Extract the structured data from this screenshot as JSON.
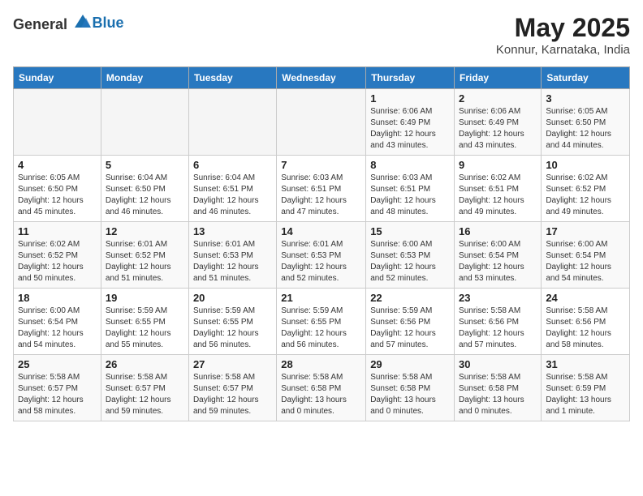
{
  "header": {
    "logo_general": "General",
    "logo_blue": "Blue",
    "month_year": "May 2025",
    "location": "Konnur, Karnataka, India"
  },
  "days_of_week": [
    "Sunday",
    "Monday",
    "Tuesday",
    "Wednesday",
    "Thursday",
    "Friday",
    "Saturday"
  ],
  "weeks": [
    [
      {
        "day": "",
        "info": ""
      },
      {
        "day": "",
        "info": ""
      },
      {
        "day": "",
        "info": ""
      },
      {
        "day": "",
        "info": ""
      },
      {
        "day": "1",
        "info": "Sunrise: 6:06 AM\nSunset: 6:49 PM\nDaylight: 12 hours\nand 43 minutes."
      },
      {
        "day": "2",
        "info": "Sunrise: 6:06 AM\nSunset: 6:49 PM\nDaylight: 12 hours\nand 43 minutes."
      },
      {
        "day": "3",
        "info": "Sunrise: 6:05 AM\nSunset: 6:50 PM\nDaylight: 12 hours\nand 44 minutes."
      }
    ],
    [
      {
        "day": "4",
        "info": "Sunrise: 6:05 AM\nSunset: 6:50 PM\nDaylight: 12 hours\nand 45 minutes."
      },
      {
        "day": "5",
        "info": "Sunrise: 6:04 AM\nSunset: 6:50 PM\nDaylight: 12 hours\nand 46 minutes."
      },
      {
        "day": "6",
        "info": "Sunrise: 6:04 AM\nSunset: 6:51 PM\nDaylight: 12 hours\nand 46 minutes."
      },
      {
        "day": "7",
        "info": "Sunrise: 6:03 AM\nSunset: 6:51 PM\nDaylight: 12 hours\nand 47 minutes."
      },
      {
        "day": "8",
        "info": "Sunrise: 6:03 AM\nSunset: 6:51 PM\nDaylight: 12 hours\nand 48 minutes."
      },
      {
        "day": "9",
        "info": "Sunrise: 6:02 AM\nSunset: 6:51 PM\nDaylight: 12 hours\nand 49 minutes."
      },
      {
        "day": "10",
        "info": "Sunrise: 6:02 AM\nSunset: 6:52 PM\nDaylight: 12 hours\nand 49 minutes."
      }
    ],
    [
      {
        "day": "11",
        "info": "Sunrise: 6:02 AM\nSunset: 6:52 PM\nDaylight: 12 hours\nand 50 minutes."
      },
      {
        "day": "12",
        "info": "Sunrise: 6:01 AM\nSunset: 6:52 PM\nDaylight: 12 hours\nand 51 minutes."
      },
      {
        "day": "13",
        "info": "Sunrise: 6:01 AM\nSunset: 6:53 PM\nDaylight: 12 hours\nand 51 minutes."
      },
      {
        "day": "14",
        "info": "Sunrise: 6:01 AM\nSunset: 6:53 PM\nDaylight: 12 hours\nand 52 minutes."
      },
      {
        "day": "15",
        "info": "Sunrise: 6:00 AM\nSunset: 6:53 PM\nDaylight: 12 hours\nand 52 minutes."
      },
      {
        "day": "16",
        "info": "Sunrise: 6:00 AM\nSunset: 6:54 PM\nDaylight: 12 hours\nand 53 minutes."
      },
      {
        "day": "17",
        "info": "Sunrise: 6:00 AM\nSunset: 6:54 PM\nDaylight: 12 hours\nand 54 minutes."
      }
    ],
    [
      {
        "day": "18",
        "info": "Sunrise: 6:00 AM\nSunset: 6:54 PM\nDaylight: 12 hours\nand 54 minutes."
      },
      {
        "day": "19",
        "info": "Sunrise: 5:59 AM\nSunset: 6:55 PM\nDaylight: 12 hours\nand 55 minutes."
      },
      {
        "day": "20",
        "info": "Sunrise: 5:59 AM\nSunset: 6:55 PM\nDaylight: 12 hours\nand 56 minutes."
      },
      {
        "day": "21",
        "info": "Sunrise: 5:59 AM\nSunset: 6:55 PM\nDaylight: 12 hours\nand 56 minutes."
      },
      {
        "day": "22",
        "info": "Sunrise: 5:59 AM\nSunset: 6:56 PM\nDaylight: 12 hours\nand 57 minutes."
      },
      {
        "day": "23",
        "info": "Sunrise: 5:58 AM\nSunset: 6:56 PM\nDaylight: 12 hours\nand 57 minutes."
      },
      {
        "day": "24",
        "info": "Sunrise: 5:58 AM\nSunset: 6:56 PM\nDaylight: 12 hours\nand 58 minutes."
      }
    ],
    [
      {
        "day": "25",
        "info": "Sunrise: 5:58 AM\nSunset: 6:57 PM\nDaylight: 12 hours\nand 58 minutes."
      },
      {
        "day": "26",
        "info": "Sunrise: 5:58 AM\nSunset: 6:57 PM\nDaylight: 12 hours\nand 59 minutes."
      },
      {
        "day": "27",
        "info": "Sunrise: 5:58 AM\nSunset: 6:57 PM\nDaylight: 12 hours\nand 59 minutes."
      },
      {
        "day": "28",
        "info": "Sunrise: 5:58 AM\nSunset: 6:58 PM\nDaylight: 13 hours\nand 0 minutes."
      },
      {
        "day": "29",
        "info": "Sunrise: 5:58 AM\nSunset: 6:58 PM\nDaylight: 13 hours\nand 0 minutes."
      },
      {
        "day": "30",
        "info": "Sunrise: 5:58 AM\nSunset: 6:58 PM\nDaylight: 13 hours\nand 0 minutes."
      },
      {
        "day": "31",
        "info": "Sunrise: 5:58 AM\nSunset: 6:59 PM\nDaylight: 13 hours\nand 1 minute."
      }
    ]
  ]
}
